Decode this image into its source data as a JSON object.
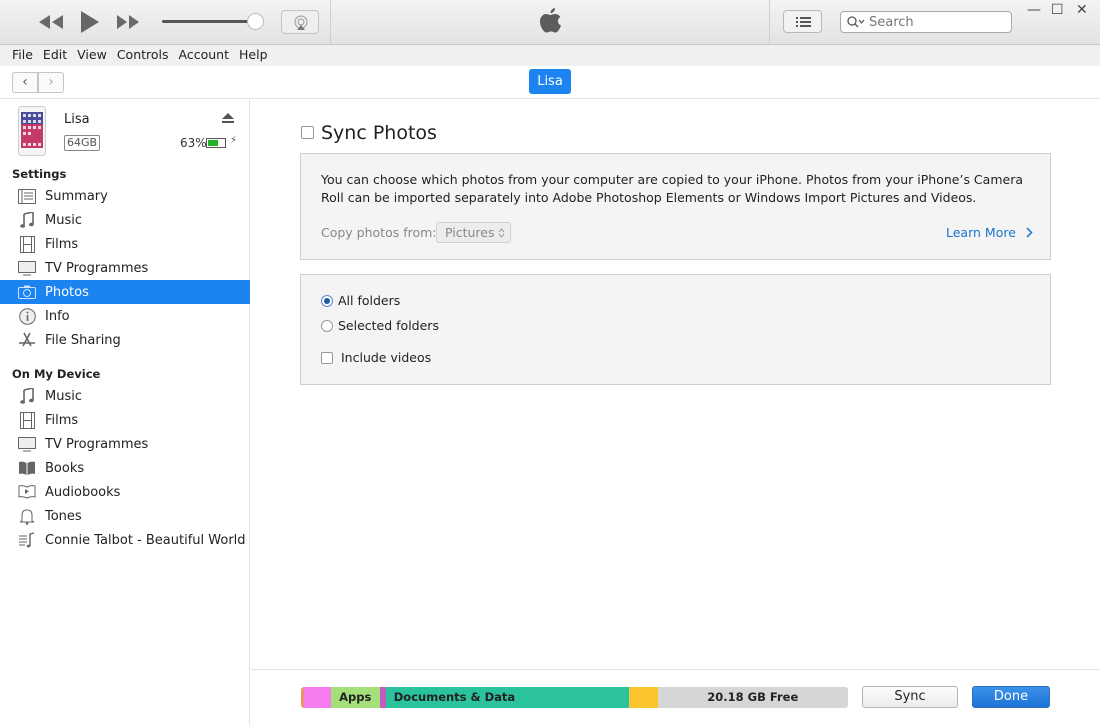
{
  "window": {
    "search_placeholder": "Search",
    "minimize": "—",
    "maximize": "☐",
    "close": "✕",
    "volume_level": 0.9
  },
  "menu": [
    "File",
    "Edit",
    "View",
    "Controls",
    "Account",
    "Help"
  ],
  "nav": {
    "back": "‹",
    "forward": "›",
    "device_tab": "Lisa"
  },
  "device": {
    "name": "Lisa",
    "capacity": "64GB",
    "battery_percent": "63%",
    "battery_level": 0.63
  },
  "sidebar": {
    "settings_heading": "Settings",
    "settings_items": [
      {
        "label": "Summary",
        "icon": "summary-icon"
      },
      {
        "label": "Music",
        "icon": "music-note-icon"
      },
      {
        "label": "Films",
        "icon": "film-icon"
      },
      {
        "label": "TV Programmes",
        "icon": "tv-icon"
      },
      {
        "label": "Photos",
        "icon": "camera-icon",
        "active": true
      },
      {
        "label": "Info",
        "icon": "info-icon"
      },
      {
        "label": "File Sharing",
        "icon": "app-store-icon"
      }
    ],
    "device_heading": "On My Device",
    "device_items": [
      {
        "label": "Music",
        "icon": "music-note-icon"
      },
      {
        "label": "Films",
        "icon": "film-icon"
      },
      {
        "label": "TV Programmes",
        "icon": "tv-icon"
      },
      {
        "label": "Books",
        "icon": "book-icon"
      },
      {
        "label": "Audiobooks",
        "icon": "audiobook-icon"
      },
      {
        "label": "Tones",
        "icon": "bell-icon"
      },
      {
        "label": "Connie Talbot - Beautiful World",
        "icon": "playlist-icon"
      }
    ]
  },
  "main": {
    "sync_title": "Sync Photos",
    "sync_checked": false,
    "description": "You can choose which photos from your computer are copied to your iPhone. Photos from your iPhone’s Camera Roll can be imported separately into Adobe Photoshop Elements or Windows Import Pictures and Videos.",
    "copy_from_label": "Copy photos from:",
    "copy_from_value": "Pictures",
    "learn_more": "Learn More",
    "options": {
      "all_folders": "All folders",
      "selected_folders": "Selected folders",
      "include_videos": "Include videos",
      "selected": "all_folders",
      "include_videos_checked": false
    }
  },
  "storage": {
    "segments": [
      {
        "label": "",
        "color": "#f0906a",
        "fraction": 0.005
      },
      {
        "label": "",
        "color": "#f67cf0",
        "fraction": 0.05
      },
      {
        "label": "Apps",
        "color": "#a4e07a",
        "fraction": 0.09
      },
      {
        "label": "",
        "color": "#c35cc0",
        "fraction": 0.01
      },
      {
        "label": "Documents & Data",
        "color": "#2bc29e",
        "fraction": 0.445
      },
      {
        "label": "",
        "color": "#fcc42c",
        "fraction": 0.052
      },
      {
        "label": "20.18 GB Free",
        "color": "#d6d6d6",
        "fraction": 0.348
      }
    ]
  },
  "footer": {
    "sync": "Sync",
    "done": "Done"
  }
}
